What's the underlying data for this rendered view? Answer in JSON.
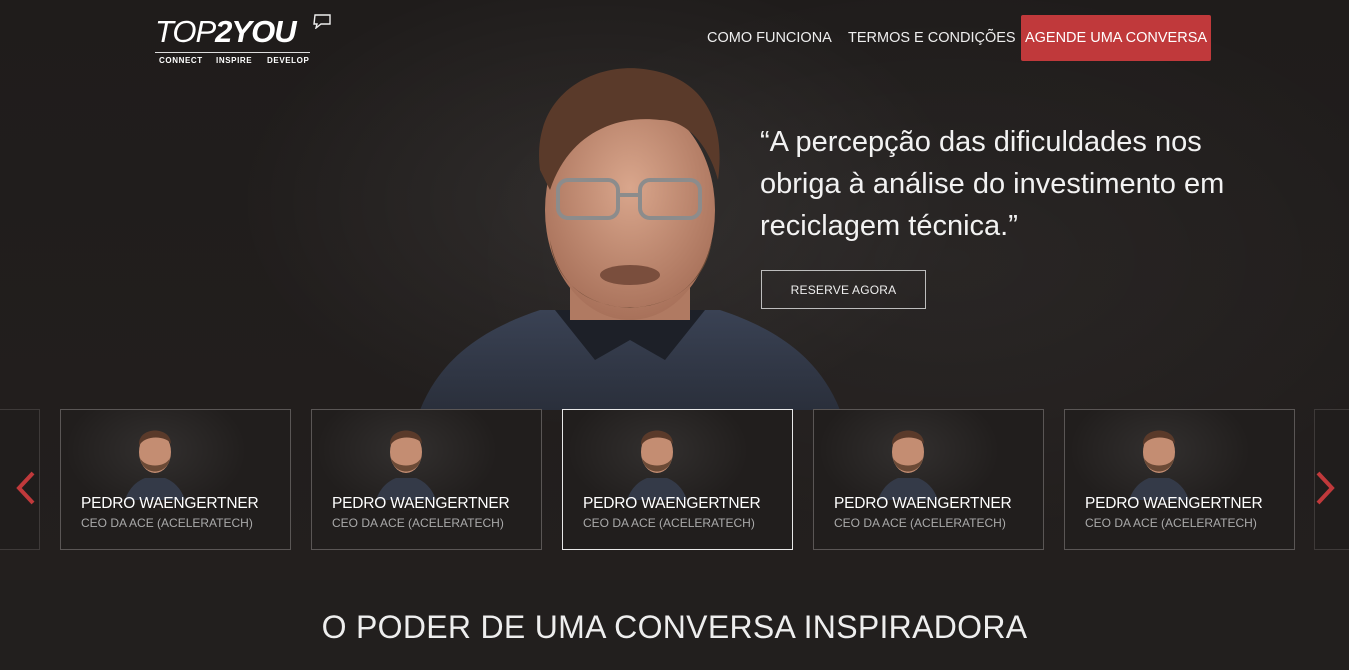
{
  "brand": {
    "logo_top": "TOP",
    "logo_2you": "2YOU",
    "tags": [
      "CONNECT",
      "INSPIRE",
      "DEVELOP"
    ]
  },
  "nav": {
    "links": [
      "COMO FUNCIONA",
      "TERMOS E CONDIÇÕES"
    ],
    "cta": "AGENDE UMA CONVERSA"
  },
  "hero": {
    "quote": "“A percepção das dificuldades nos obriga à análise do investimento em reciclagem técnica.”",
    "reserve_label": "RESERVE AGORA"
  },
  "carousel": {
    "cards": [
      {
        "name": "PEDRO WAENGERTNER",
        "role": "CEO DA ACE (ACELERATECH)"
      },
      {
        "name": "PEDRO WAENGERTNER",
        "role": "CEO DA ACE (ACELERATECH)"
      },
      {
        "name": "PEDRO WAENGERTNER",
        "role": "CEO DA ACE (ACELERATECH)"
      },
      {
        "name": "PEDRO WAENGERTNER",
        "role": "CEO DA ACE (ACELERATECH)"
      },
      {
        "name": "PEDRO WAENGERTNER",
        "role": "CEO DA ACE (ACELERATECH)"
      }
    ],
    "active_index": 2,
    "prev_icon": "chevron-left-icon",
    "next_icon": "chevron-right-icon"
  },
  "section": {
    "tagline": "O PODER DE UMA CONVERSA INSPIRADORA"
  },
  "colors": {
    "accent": "#c0393b",
    "background": "#221f1e"
  }
}
